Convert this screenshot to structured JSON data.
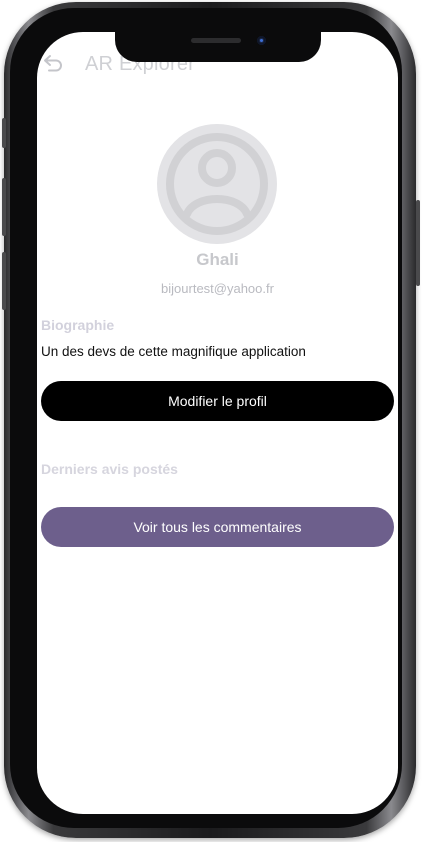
{
  "header": {
    "back_icon": "back-arrow-icon",
    "title": "AR Explorer"
  },
  "profile": {
    "avatar_icon": "user-avatar-icon",
    "name": "Ghali",
    "email": "bijourtest@yahoo.fr"
  },
  "biography": {
    "heading": "Biographie",
    "text": "Un des devs de cette magnifique application"
  },
  "actions": {
    "edit_profile_label": "Modifier le profil",
    "view_comments_label": "Voir tous les commentaires"
  },
  "reviews": {
    "heading": "Derniers avis postés"
  },
  "colors": {
    "edit_button": "#000000",
    "comments_button": "#6d5f8c",
    "muted_text": "#c7c8cc"
  }
}
